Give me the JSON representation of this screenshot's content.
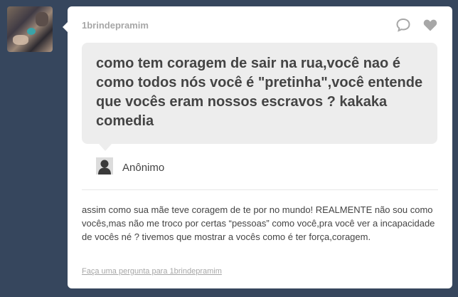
{
  "post": {
    "username": "1brindepramim",
    "question": "como tem coragem de sair na rua,você nao é como todos nós você é \"pretinha\",você entende que vocês eram nossos escravos ? kakaka comedia",
    "asker": "Anônimo",
    "answer": "assim como sua mãe teve coragem de te por no mundo! REALMENTE não sou como vocês,mas não me troco por certas “pessoas” como você,pra você ver a incapacidade de vocês né ? tivemos que mostrar a vocês como é ter força,coragem.",
    "ask_link": "Faça uma pergunta para 1brindepramim"
  },
  "icons": {
    "reply": "reply-bubble-icon",
    "like": "heart-icon",
    "asker": "anonymous-silhouette-icon"
  },
  "colors": {
    "background": "#36465d",
    "card": "#ffffff",
    "bubble": "#ededed",
    "text": "#444444",
    "muted": "#a7a7a7"
  }
}
